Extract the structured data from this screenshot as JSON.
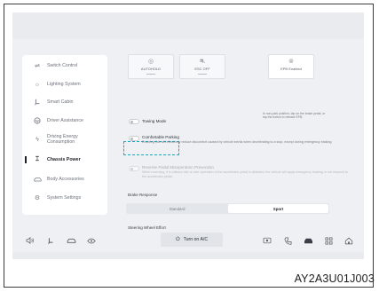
{
  "sidebar": {
    "items": [
      {
        "label": "Switch Control",
        "icon": "sliders-icon",
        "active": false
      },
      {
        "label": "Lighting System",
        "icon": "sun-icon",
        "active": false
      },
      {
        "label": "Smart Cabin",
        "icon": "seat-icon",
        "active": false
      },
      {
        "label": "Driver Assistance",
        "icon": "steering-wheel-icon",
        "active": false
      },
      {
        "label": "Driving Energy Consumption",
        "icon": "energy-icon",
        "active": false
      },
      {
        "label": "Chassis Power",
        "icon": "chassis-icon",
        "active": true
      },
      {
        "label": "Body Accessories",
        "icon": "car-icon",
        "active": false
      },
      {
        "label": "System Settings",
        "icon": "gear-icon",
        "active": false
      }
    ]
  },
  "modes": [
    {
      "label": "AUTOHOLD",
      "icon": "autohold-icon"
    },
    {
      "label": "ESC OFF",
      "icon": "esc-icon"
    },
    {
      "label": "EPB Enabled",
      "icon": "epb-icon"
    }
  ],
  "epb_hint": "In non-park position, tap on the brake pedal, or tap the button to release EPB.",
  "options": {
    "towing": {
      "title": "Towing Mode"
    },
    "comfortable_parking": {
      "title": "Comfortable Parking",
      "desc": "Enabling this will effectively reduce discomfort caused by vehicle inertia when decelerating to a stop, except during emergency braking"
    },
    "reverse_pedal": {
      "title": "Reverse Pedal Misoperation Prevention",
      "desc": "When reversing, if a collision risk or user operation of the accelerator pedal is detected, the vehicle will apply emergency braking or not respond to the accelerator pedal."
    }
  },
  "brake_response": {
    "title": "Brake Response",
    "options": [
      "Standard",
      "Sport"
    ],
    "selected": "Sport"
  },
  "steering": {
    "title": "Steering Wheel Effort"
  },
  "dock": {
    "ac_label": "Turn on A/C",
    "left_icons": [
      "volume-icon",
      "seat-icon",
      "car-icon",
      "fan-icon"
    ],
    "right_icons": [
      "media-icon",
      "phone-icon",
      "vehicle-icon",
      "apps-icon",
      "home-icon"
    ]
  },
  "figure_code": "AY2A3U01J003"
}
